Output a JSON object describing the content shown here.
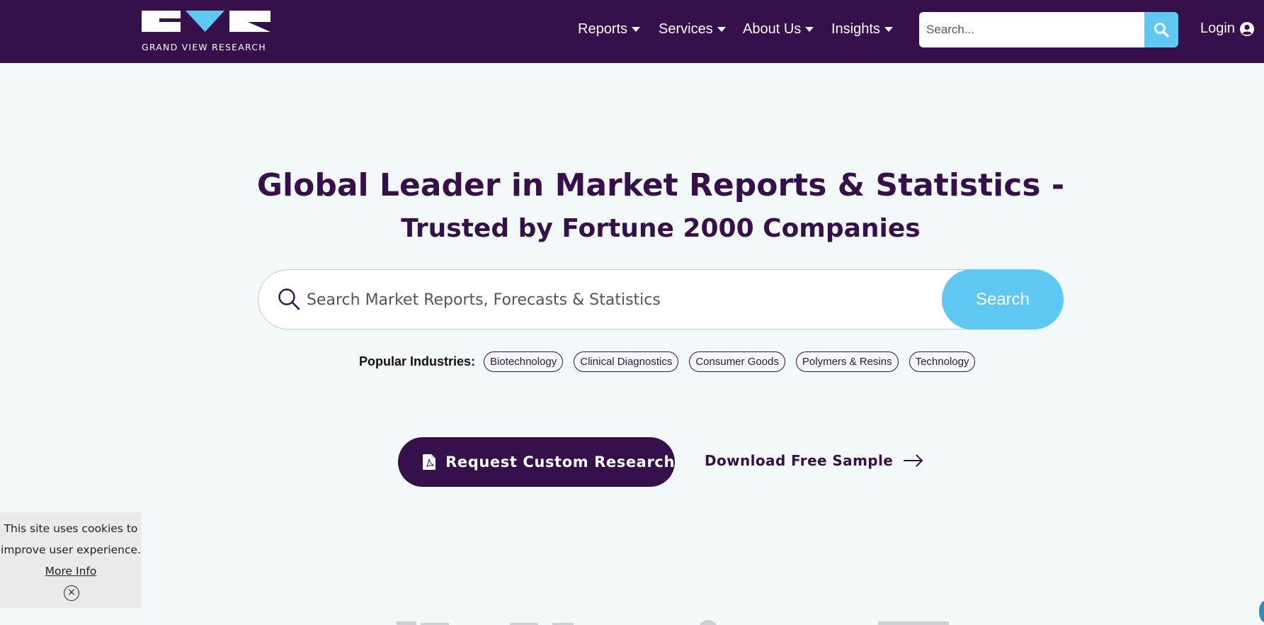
{
  "brand": {
    "name": "GRAND VIEW RESEARCH"
  },
  "nav": {
    "items": [
      {
        "label": "Reports"
      },
      {
        "label": "Services"
      },
      {
        "label": "About Us"
      },
      {
        "label": "Insights"
      }
    ],
    "search_placeholder": "Search...",
    "login_label": "Login"
  },
  "hero": {
    "title_line1": "Global Leader in Market Reports & Statistics -",
    "title_line2": "Trusted by Fortune 2000 Companies",
    "search_placeholder": "Search Market Reports, Forecasts & Statistics",
    "search_button": "Search"
  },
  "popular": {
    "label": "Popular Industries:",
    "chips": [
      "Biotechnology",
      "Clinical Diagnostics",
      "Consumer Goods",
      "Polymers & Resins",
      "Technology"
    ]
  },
  "cta": {
    "request_label": "Request Custom Research",
    "sample_label": "Download Free Sample"
  },
  "cookie": {
    "text": "This site uses cookies to improve user experience.",
    "more_info": "More Info",
    "close_symbol": "×"
  },
  "colors": {
    "brand_purple": "#36104a",
    "accent_blue": "#5ec8f2",
    "page_bg": "#f3f8fb"
  }
}
